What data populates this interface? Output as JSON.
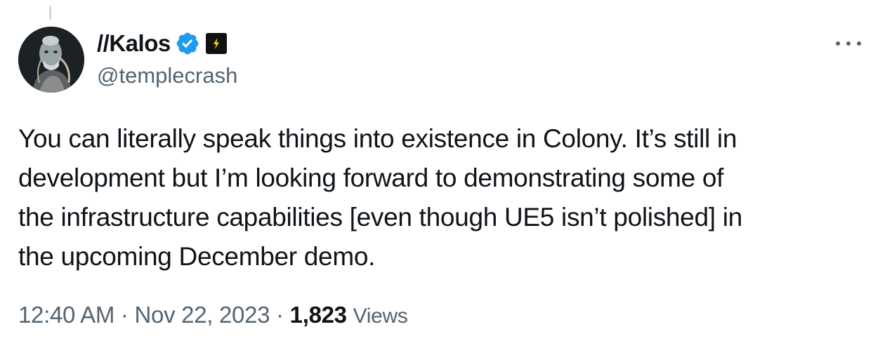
{
  "author": {
    "display_name": "//Kalos",
    "handle": "@templecrash",
    "verified": true,
    "verified_color": "#1d9bf0",
    "affiliate_badge_icon": "lightning-bolt-icon",
    "avatar_icon": "avatar-portrait"
  },
  "tweet": {
    "text_lines": [
      "You can literally speak things into existence in Colony. It’s still in",
      "development but I’m looking forward to demonstrating some of",
      "the infrastructure capabilities [even though UE5 isn’t polished] in",
      "the upcoming December demo."
    ]
  },
  "meta": {
    "time": "12:40 AM",
    "separator": "·",
    "date": "Nov 22, 2023",
    "views_count": "1,823",
    "views_label": "Views"
  },
  "actions": {
    "more_icon": "more-horizontal-icon"
  },
  "colors": {
    "text_primary": "#0f1419",
    "text_secondary": "#536471",
    "thread_line": "#cfd9de"
  }
}
